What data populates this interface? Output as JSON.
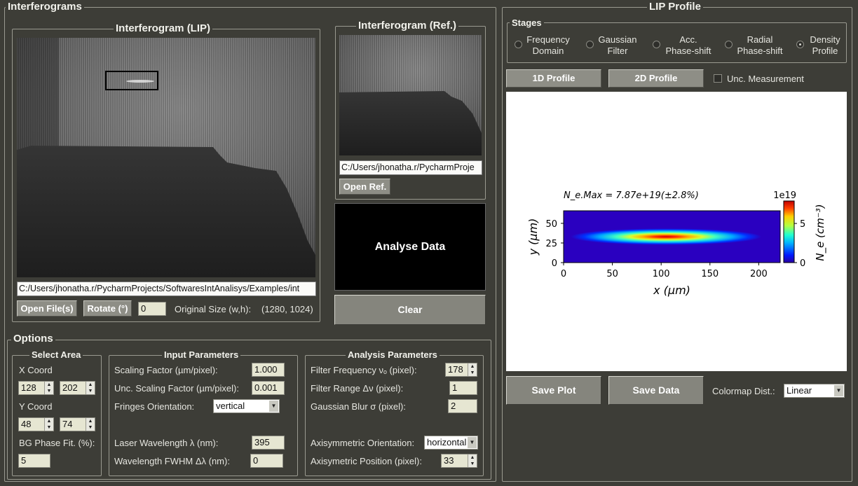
{
  "interferograms": {
    "title": "Interferograms",
    "lip": {
      "title": "Interferogram (LIP)",
      "path": "C:/Users/jhonatha.r/PycharmProjects/SoftwaresIntAnalisys/Examples/int",
      "open_label": "Open File(s)",
      "rotate_label": "Rotate (°)",
      "rotate_value": "0",
      "original_size_label": "Original Size (w,h):",
      "original_size_value": "(1280, 1024)"
    },
    "ref": {
      "title": "Interferogram (Ref.)",
      "path": "C:/Users/jhonatha.r/PycharmProje",
      "open_label": "Open Ref."
    },
    "analyse_label": "Analyse Data",
    "clear_label": "Clear"
  },
  "options": {
    "title": "Options",
    "select_area": {
      "title": "Select Area",
      "x_label": "X Coord",
      "x1": "128",
      "x2": "202",
      "y_label": "Y Coord",
      "y1": "48",
      "y2": "74",
      "bg_label": "BG Phase Fit. (%):",
      "bg_value": "5"
    },
    "input": {
      "title": "Input Parameters",
      "scaling_label": "Scaling Factor (µm/pixel):",
      "scaling_value": "1.000",
      "unc_scaling_label": "Unc. Scaling Factor (µm/pixel):",
      "unc_scaling_value": "0.001",
      "fringes_label": "Fringes Orientation:",
      "fringes_value": "vertical",
      "laser_label": "Laser Wavelength λ (nm):",
      "laser_value": "395",
      "fwhm_label": "Wavelength FWHM Δλ (nm):",
      "fwhm_value": "0"
    },
    "analysis": {
      "title": "Analysis Parameters",
      "filter_freq_label": "Filter Frequency   νₒ (pixel):",
      "filter_freq_value": "178",
      "filter_range_label": "Filter Range  Δν (pixel):",
      "filter_range_value": "1",
      "blur_label": "Gaussian Blur σ (pixel):",
      "blur_value": "2",
      "axi_orient_label": "Axisymmetric Orientation:",
      "axi_orient_value": "horizontal",
      "axi_pos_label": "Axisymetric Position (pixel):",
      "axi_pos_value": "33"
    }
  },
  "lip_profile": {
    "title": "LIP Profile",
    "stages_title": "Stages",
    "stages": [
      {
        "line1": "Frequency",
        "line2": "Domain",
        "selected": false
      },
      {
        "line1": "Gaussian",
        "line2": "Filter",
        "selected": false
      },
      {
        "line1": "Acc.",
        "line2": "Phase-shift",
        "selected": false
      },
      {
        "line1": "Radial",
        "line2": "Phase-shift",
        "selected": false
      },
      {
        "line1": "Density",
        "line2": "Profile",
        "selected": true
      }
    ],
    "profile_1d_label": "1D Profile",
    "profile_2d_label": "2D Profile",
    "unc_label": "Unc. Measurement",
    "save_plot_label": "Save Plot",
    "save_data_label": "Save Data",
    "colormap_label": "Colormap Dist.:",
    "colormap_value": "Linear"
  },
  "chart_data": {
    "type": "heatmap",
    "title": "N_e.Max = 7.87e+19(±2.8%)",
    "xlabel": "x (µm)",
    "ylabel": "y (µm)",
    "xlim": [
      0,
      222
    ],
    "ylim": [
      0,
      66
    ],
    "xticks": [
      0,
      50,
      100,
      150,
      200
    ],
    "yticks": [
      0,
      25,
      50
    ],
    "colorbar": {
      "label": "N_e (cm⁻³)",
      "multiplier": "1e19",
      "ticks": [
        0,
        5
      ],
      "range": [
        0,
        7.87
      ],
      "colormap": "jet"
    },
    "peak": {
      "x": 105,
      "y": 33,
      "value": 7.87
    }
  }
}
